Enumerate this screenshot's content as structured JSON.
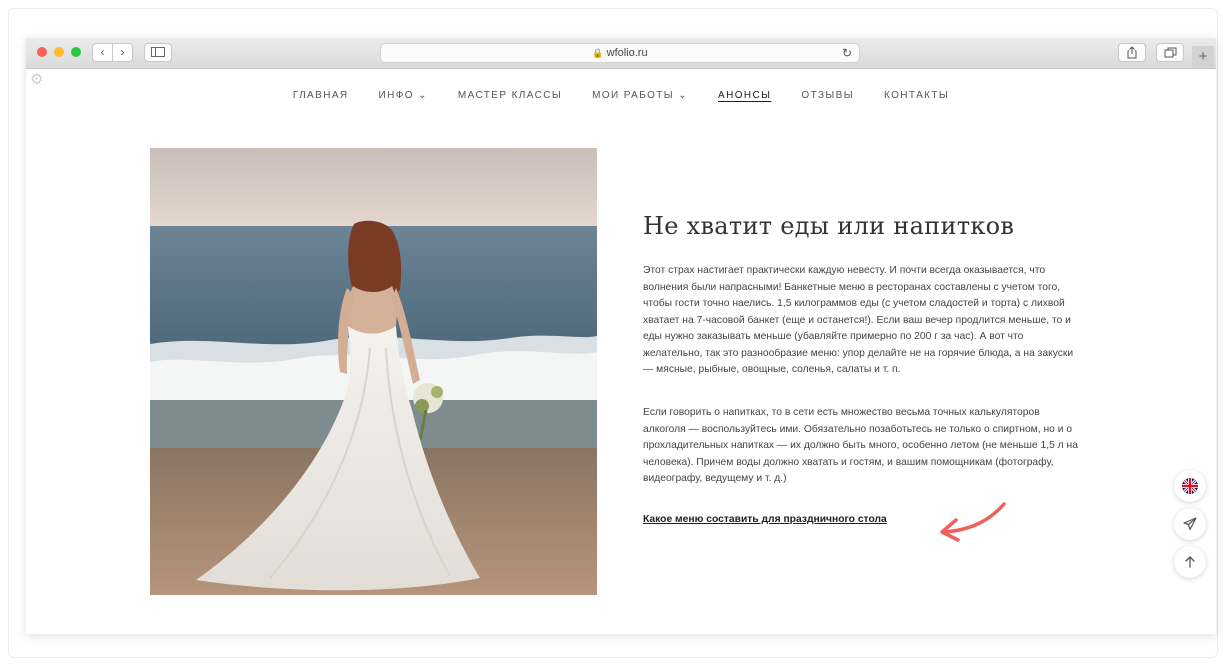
{
  "browser": {
    "url": "wfolio.ru",
    "back_icon": "‹",
    "forward_icon": "›",
    "reload_icon": "↻",
    "new_tab_label": "+"
  },
  "nav": {
    "items": [
      {
        "label": "ГЛАВНАЯ"
      },
      {
        "label": "ИНФО ⌄"
      },
      {
        "label": "МАСТЕР КЛАССЫ"
      },
      {
        "label": "МОИ РАБОТЫ ⌄"
      },
      {
        "label": "АНОНСЫ"
      },
      {
        "label": "ОТЗЫВЫ"
      },
      {
        "label": "КОНТАКТЫ"
      }
    ],
    "active": "АНОНСЫ"
  },
  "article": {
    "heading": "Не хватит еды или напитков",
    "paragraph1": "Этот страх настигает практически каждую невесту. И почти всегда оказывается, что волнения были напрасными! Банкетные меню в ресторанах составлены с учетом того, чтобы гости точно наелись. 1,5 килограммов еды (с учетом сладостей и торта) с лихвой хватает на 7-часовой банкет (еще и останется!). Если ваш вечер продлится меньше, то и еды нужно заказывать меньше (убавляйте примерно по 200 г за час). А вот что желательно, так это разнообразие меню: упор делайте не на горячие блюда, а на закуски — мясные, рыбные, овощные, соленья, салаты и т. п.",
    "paragraph2": "Если говорить о напитках, то в сети есть множество весьма точных калькуляторов алкоголя — воспользуйтесь ими. Обязательно позаботьтесь не только о спиртном, но и о прохладительных напитках — их должно быть много, особенно летом (не меньше 1,5 л на человека). Причем воды должно хватать и гостям, и вашим помощникам (фотографу, видеографу, ведущему и т. д.)",
    "link": "Какое меню составить для праздничного стола"
  },
  "colors": {
    "accent_arrow": "#f0605a",
    "flag_red": "#cf142b",
    "flag_blue": "#00247d"
  },
  "icons": [
    "settings-gear-icon",
    "uk-flag-icon",
    "telegram-plane-icon",
    "arrow-up-icon",
    "share-icon",
    "tabs-icon",
    "lock-icon"
  ]
}
